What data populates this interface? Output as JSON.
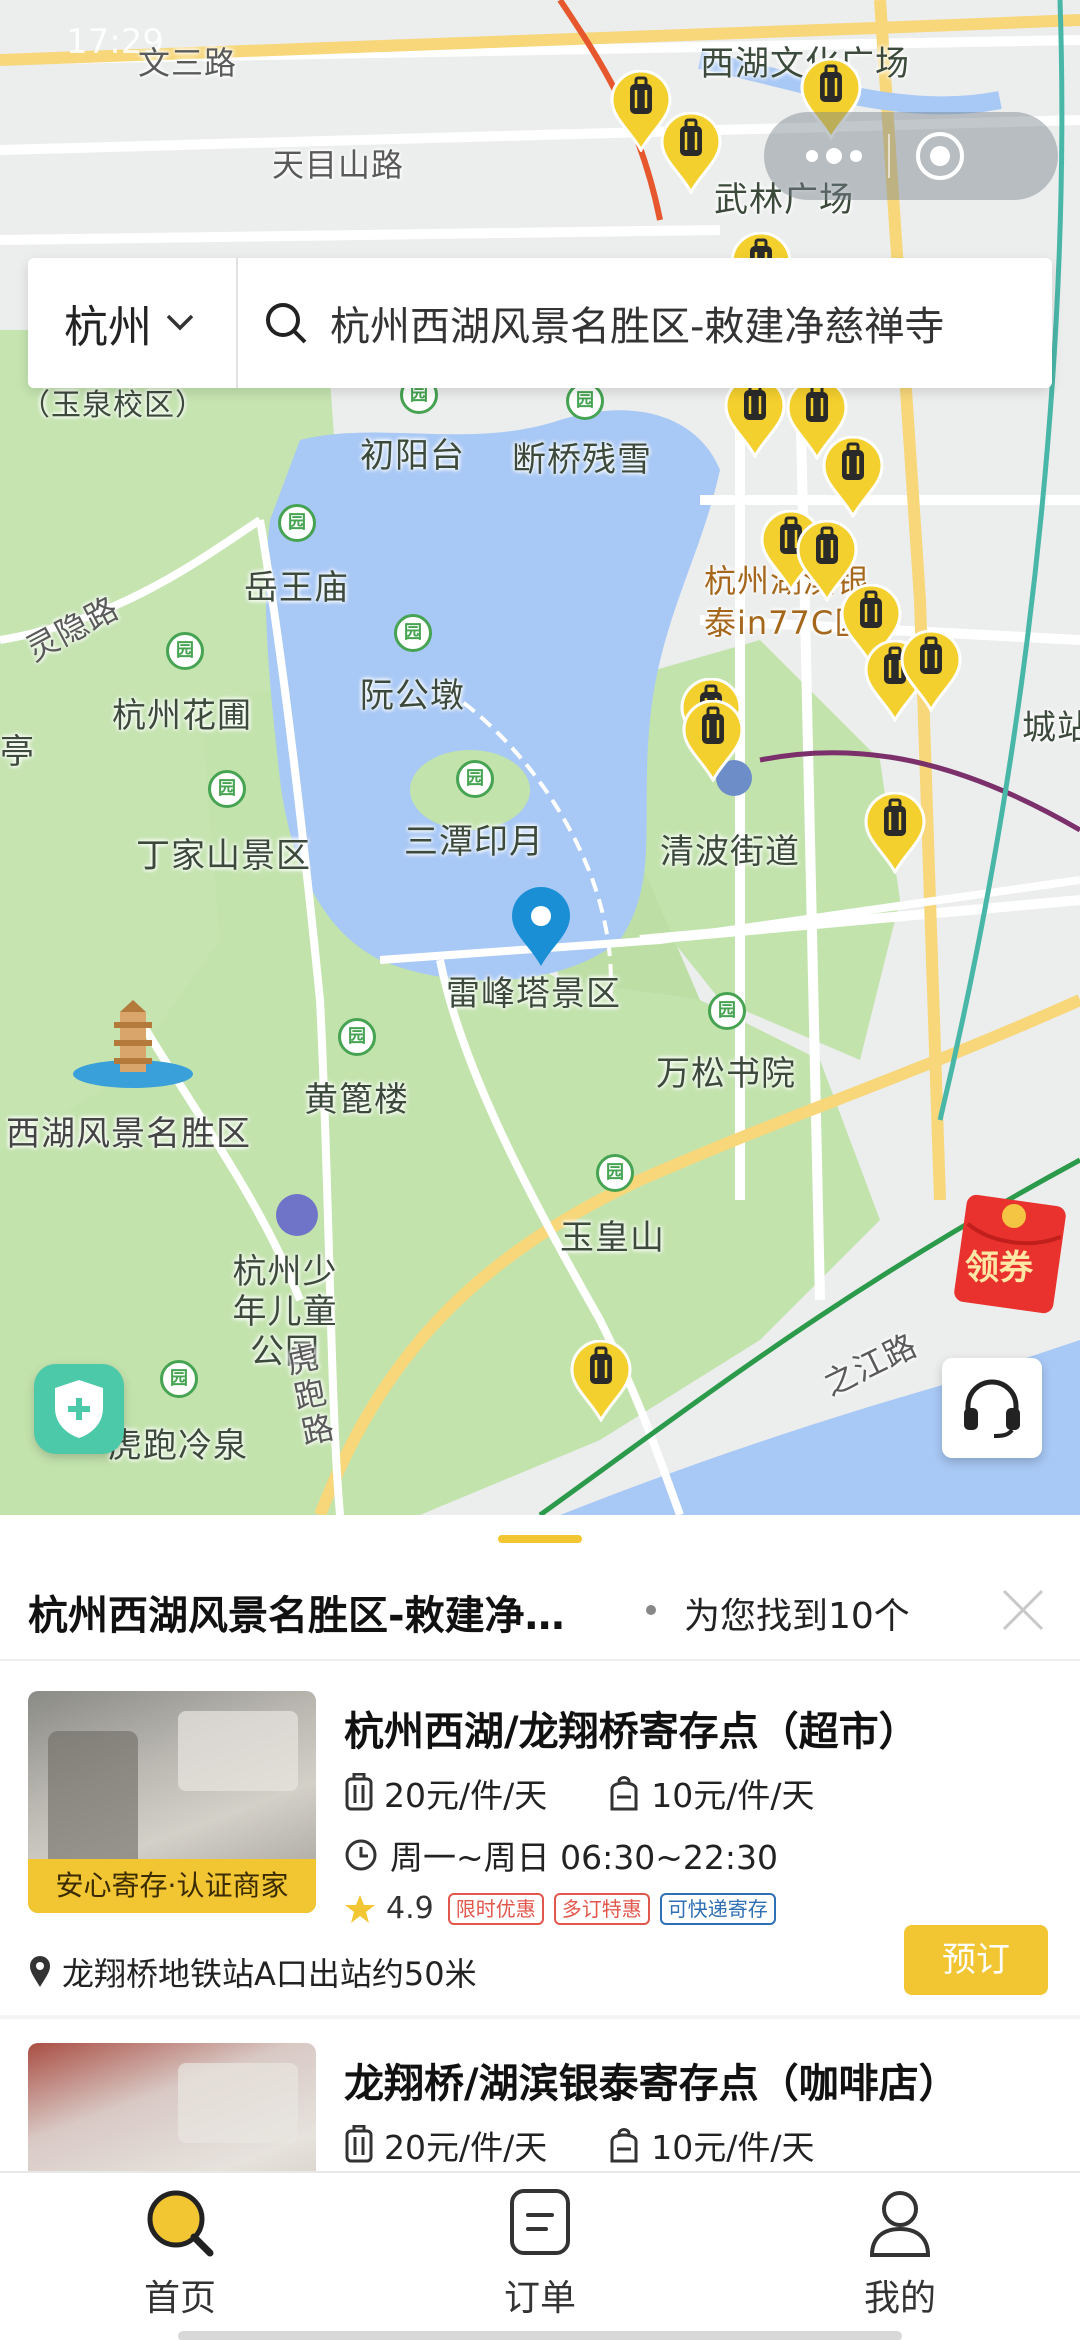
{
  "status_bar": {
    "time": "17:29"
  },
  "search": {
    "city": "杭州",
    "query": "杭州西湖风景名胜区-敕建净慈禅寺"
  },
  "map": {
    "labels": {
      "wensan_road": "文三路",
      "tianmushan_road": "天目山路",
      "xihu_culture_square": "西湖文化广场",
      "wulin_square": "武林广场",
      "yuquan_campus": "（玉泉校区）",
      "chuyangtai": "初阳台",
      "duanqiao": "断桥残雪",
      "yuewang_temple": "岳王庙",
      "lingyin_road": "灵隐路",
      "ruangongdun": "阮公墩",
      "hangzhou_garden": "杭州花圃",
      "ting": "亭",
      "hubin_yintai": "杭州湖滨银泰in77C区",
      "chengzhan": "城站",
      "santan_yinyue": "三潭印月",
      "dingjiashan": "丁家山景区",
      "qingbo_street": "清波街道",
      "leifeng_tower": "雷峰塔景区",
      "wansong_academy": "万松书院",
      "huangbilou": "黄篦楼",
      "west_lake_area": "西湖风景名胜区",
      "yuhuangshan": "玉皇山",
      "children_park": "杭州少年儿童公园",
      "hupao_road": "虎跑路",
      "hupao_spring": "虎跑冷泉",
      "zhijiang_road": "之江路"
    },
    "coupon_label": "领券"
  },
  "results": {
    "place": "杭州西湖风景名胜区-敕建净…",
    "count_text": "为您找到10个"
  },
  "cards": [
    {
      "title": "杭州西湖/龙翔桥寄存点（超市）",
      "badge": "安心寄存·认证商家",
      "price_large": "20元/件/天",
      "price_small": "10元/件/天",
      "hours": "周一~周日 06:30~22:30",
      "rating": "4.9",
      "tags": [
        "限时优惠",
        "多订特惠",
        "可快递寄存"
      ],
      "location": "龙翔桥地铁站A口出站约50米",
      "book_label": "预订"
    },
    {
      "title": "龙翔桥/湖滨银泰寄存点（咖啡店）",
      "price_large": "20元/件/天",
      "price_small": "10元/件/天"
    }
  ],
  "tabbar": {
    "home": "首页",
    "orders": "订单",
    "mine": "我的"
  },
  "colors": {
    "accent": "#f2c533",
    "lake": "#a8c8f5",
    "park": "#c3e3ad",
    "tag_red": "#e2574c",
    "tag_blue": "#2f6fb3"
  }
}
